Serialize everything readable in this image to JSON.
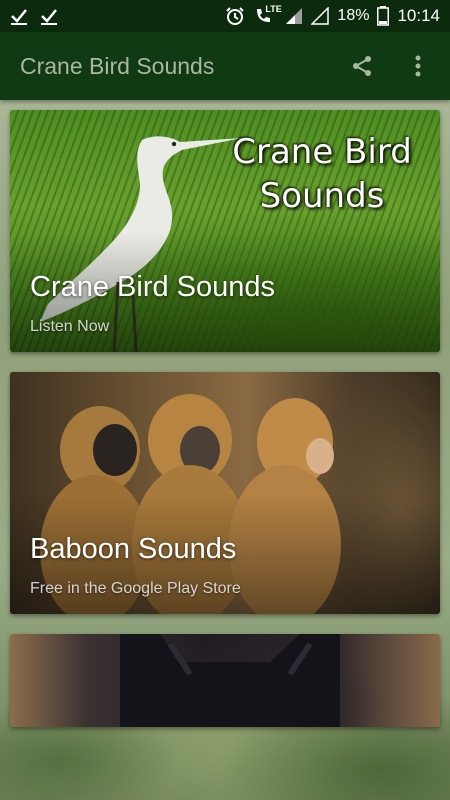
{
  "statusbar": {
    "battery_pct": "18%",
    "time": "10:14",
    "lte_label": "LTE",
    "icons": [
      "check-icon",
      "check-icon",
      "alarm-icon",
      "wifi-calling-icon",
      "signal-icon",
      "signal-empty-icon",
      "battery-icon"
    ]
  },
  "appbar": {
    "title": "Crane Bird Sounds",
    "share_icon": "share-icon",
    "menu_icon": "more-vert-icon"
  },
  "cards": [
    {
      "title": "Crane Bird Sounds",
      "subtitle": "Listen Now",
      "image_title_line1": "Crane Bird",
      "image_title_line2": "Sounds"
    },
    {
      "title": "Baboon Sounds",
      "subtitle": "Free in the Google Play Store"
    },
    {
      "title": "",
      "subtitle": ""
    }
  ],
  "colors": {
    "statusbar": "#0c2a0e",
    "appbar": "#0f3a12",
    "appbar_title": "#a9b7a1"
  }
}
